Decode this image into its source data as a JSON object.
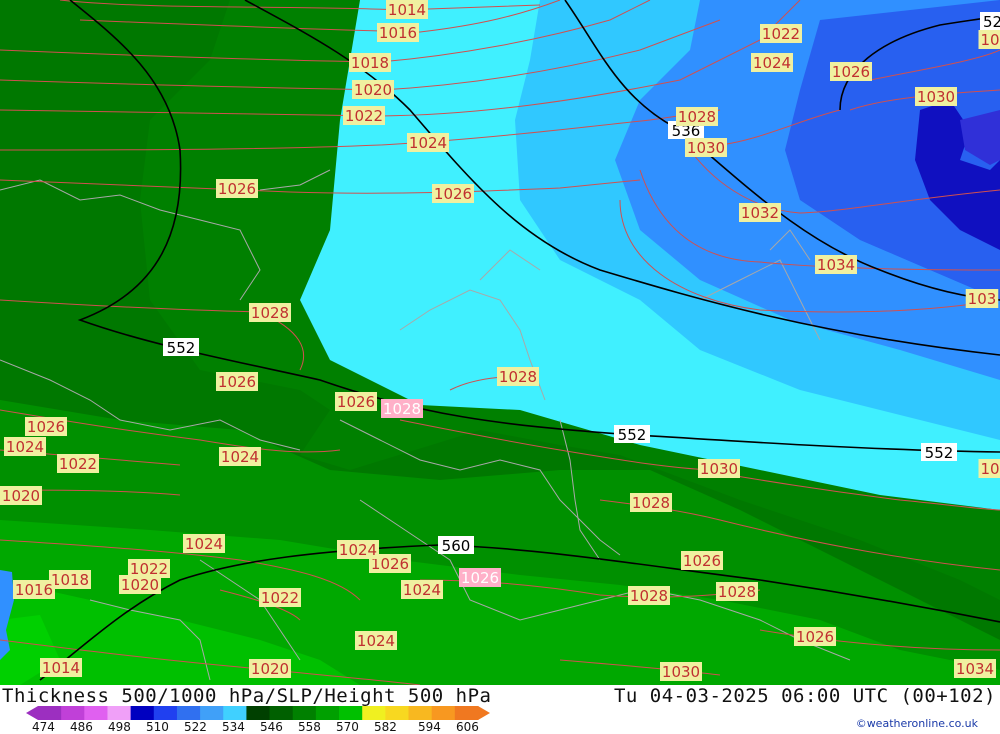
{
  "title_left": "Thickness 500/1000 hPa/SLP/Height 500 hPa",
  "title_right": "Tu 04-03-2025 06:00 UTC (00+102)",
  "credit": "©weatheronline.co.uk",
  "legend": {
    "ticks": [
      "474",
      "486",
      "498",
      "510",
      "522",
      "534",
      "546",
      "558",
      "570",
      "582",
      "594",
      "606"
    ],
    "colors": [
      "#9c2fc0",
      "#c040d8",
      "#e060f0",
      "#f0a0f8",
      "#0000c0",
      "#2040f0",
      "#3070f0",
      "#40a0f8",
      "#40d0ff",
      "#004000",
      "#006000",
      "#008000",
      "#00a000",
      "#00c000",
      "#f0f020",
      "#f8d820",
      "#f8b820",
      "#f89820",
      "#f07820"
    ]
  },
  "colors": {
    "slp_isobar": "#d05050",
    "height_contour": "#000000",
    "border": "#a0a0a0",
    "slp_label_bg": "#f0f0a0",
    "slp_label_text": "#c03030",
    "slp_label_pink_bg": "#ffb0c8"
  },
  "slp_labels": [
    {
      "text": "1014"
    },
    {
      "text": "1016"
    },
    {
      "text": "1018"
    },
    {
      "text": "1020"
    },
    {
      "text": "1022"
    },
    {
      "text": "1024"
    },
    {
      "text": "1026"
    },
    {
      "text": "1026"
    },
    {
      "text": "1028"
    },
    {
      "text": "1026"
    },
    {
      "text": "1026"
    },
    {
      "text": "1028"
    },
    {
      "text": "1028"
    },
    {
      "text": "1022"
    },
    {
      "text": "1024"
    },
    {
      "text": "1026"
    },
    {
      "text": "1030"
    },
    {
      "text": "1028"
    },
    {
      "text": "1030"
    },
    {
      "text": "1032"
    },
    {
      "text": "1034"
    },
    {
      "text": "103"
    },
    {
      "text": "1026"
    },
    {
      "text": "1024"
    },
    {
      "text": "1022"
    },
    {
      "text": "1020"
    },
    {
      "text": "1024"
    },
    {
      "text": "1030"
    },
    {
      "text": "1028"
    },
    {
      "text": "1024"
    },
    {
      "text": "1026"
    },
    {
      "text": "1026"
    },
    {
      "text": "1022"
    },
    {
      "text": "1020"
    },
    {
      "text": "1018"
    },
    {
      "text": "1016"
    },
    {
      "text": "1024"
    },
    {
      "text": "1022"
    },
    {
      "text": "1024"
    },
    {
      "text": "1024"
    },
    {
      "text": "1028"
    },
    {
      "text": "1026"
    },
    {
      "text": "1014"
    },
    {
      "text": "1020"
    },
    {
      "text": "1030"
    },
    {
      "text": "1034"
    },
    {
      "text": "10"
    },
    {
      "text": "10"
    },
    {
      "text": "1028"
    },
    {
      "text": "1026"
    }
  ],
  "height_labels": [
    {
      "text": "536"
    },
    {
      "text": "552"
    },
    {
      "text": "552"
    },
    {
      "text": "552"
    },
    {
      "text": "560"
    },
    {
      "text": "52"
    }
  ]
}
